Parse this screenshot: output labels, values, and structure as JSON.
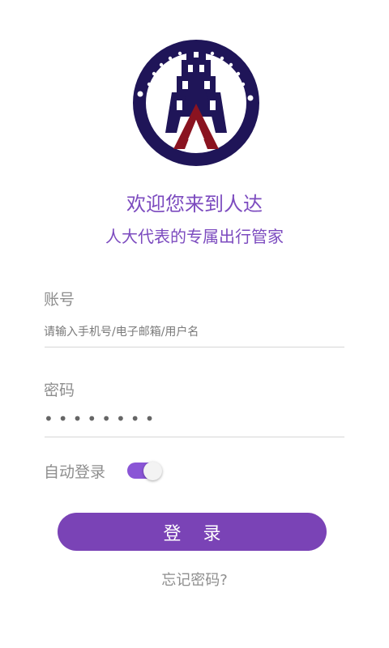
{
  "logo": {
    "name": "people-congress-logo",
    "ring_color": "#1f1558",
    "accent_color": "#8a1320"
  },
  "welcome": {
    "line1": "欢迎您来到人达",
    "line2": "人大代表的专属出行管家",
    "color": "#7c4bbf"
  },
  "form": {
    "account": {
      "label": "账号",
      "placeholder": "请输入手机号/电子邮箱/用户名",
      "value": ""
    },
    "password": {
      "label": "密码",
      "value": "********"
    },
    "auto_login": {
      "label": "自动登录",
      "enabled": true,
      "color": "#8a55d6"
    }
  },
  "actions": {
    "login_label": "登 录",
    "login_color": "#7a43b6",
    "forgot_label": "忘记密码?"
  }
}
